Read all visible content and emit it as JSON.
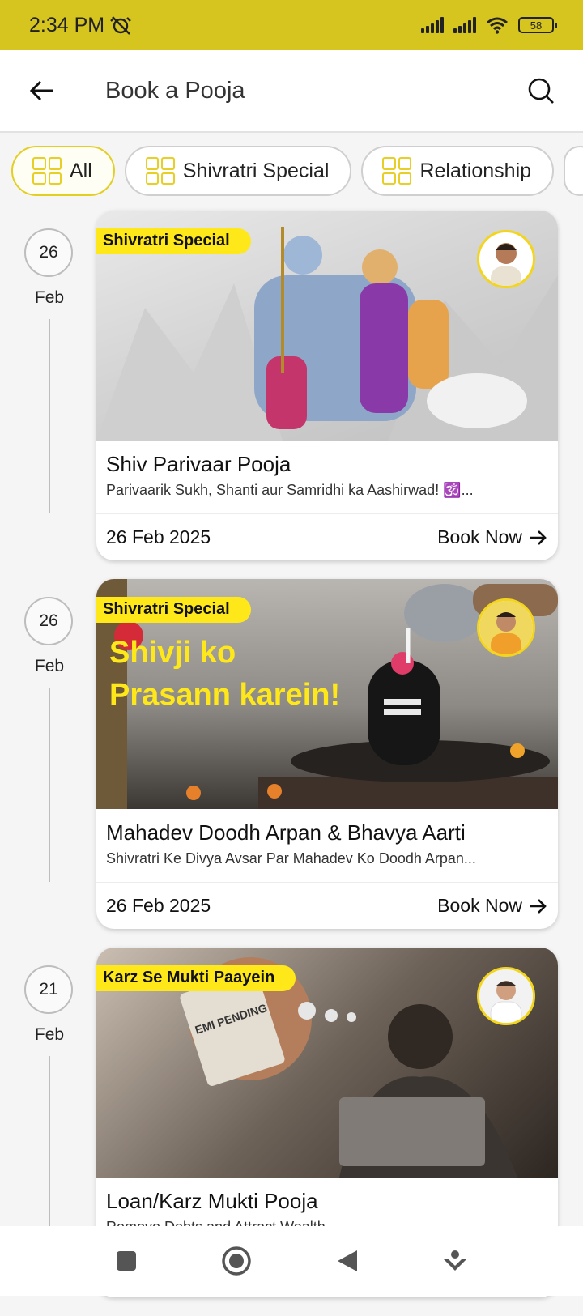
{
  "status_bar": {
    "time": "2:34 PM",
    "battery": "58"
  },
  "header": {
    "title": "Book a Pooja"
  },
  "filters": [
    {
      "label": "All",
      "active": true
    },
    {
      "label": "Shivratri Special",
      "active": false
    },
    {
      "label": "Relationship",
      "active": false
    }
  ],
  "poojas": [
    {
      "day": "26",
      "month": "Feb",
      "tag": "Shivratri Special",
      "title": "Shiv Parivaar Pooja",
      "subtitle": "Parivaarik Sukh, Shanti aur Samridhi ka Aashirwad! 🕉️...",
      "date": "26 Feb 2025",
      "cta": "Book Now"
    },
    {
      "day": "26",
      "month": "Feb",
      "tag": "Shivratri Special",
      "banner_text_1": "Shivji ko",
      "banner_text_2": "Prasann karein!",
      "title": "Mahadev Doodh Arpan & Bhavya Aarti",
      "subtitle": "Shivratri Ke Divya Avsar Par Mahadev Ko Doodh Arpan...",
      "date": "26 Feb 2025",
      "cta": "Book Now"
    },
    {
      "day": "21",
      "month": "Feb",
      "tag": "Karz Se Mukti Paayein",
      "banner_text_1": "EMI PENDING",
      "title": "Loan/Karz Mukti Pooja",
      "subtitle": "Remove Debts and Attract Wealth",
      "date": "",
      "cta": ""
    }
  ],
  "colors": {
    "accent": "#d6c41f",
    "tag": "#ffe81a"
  }
}
